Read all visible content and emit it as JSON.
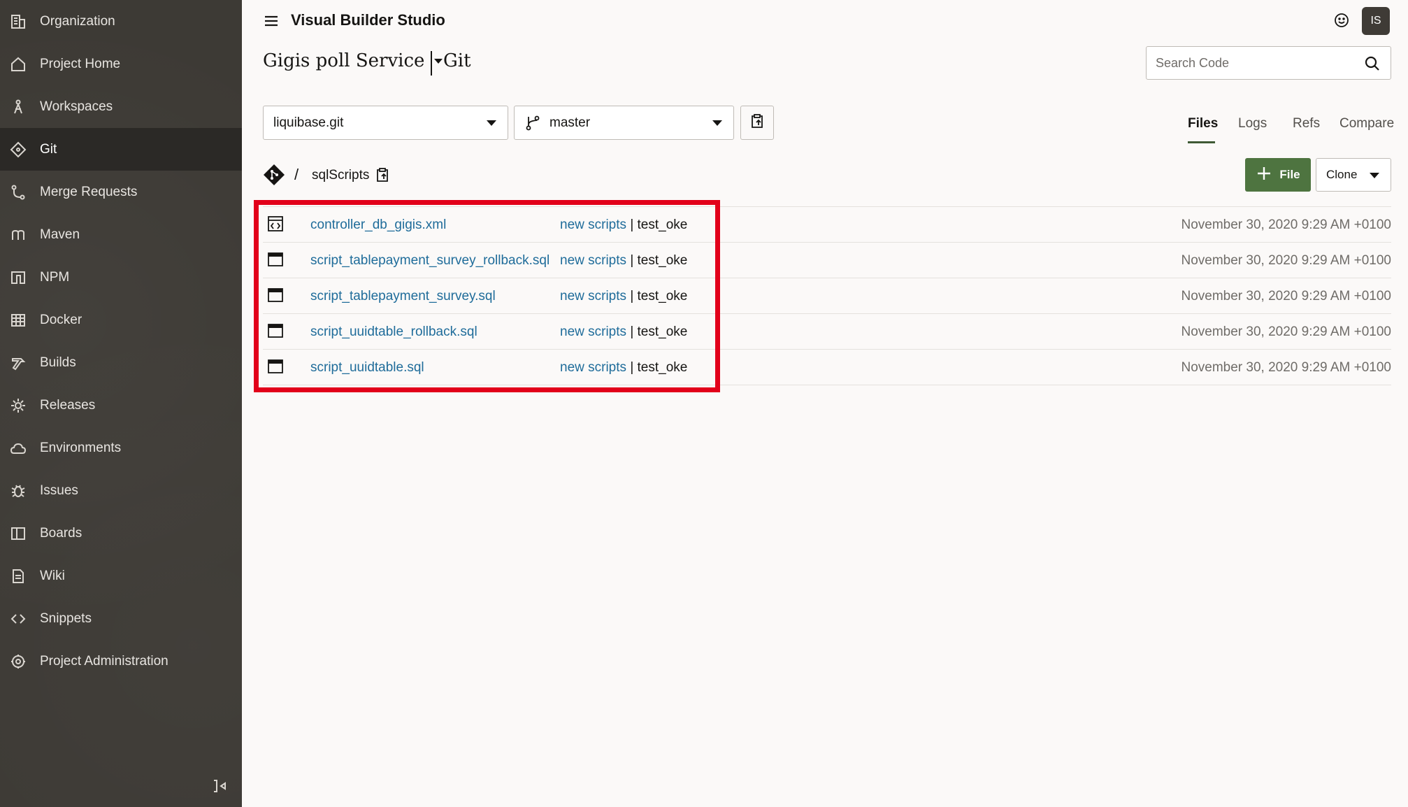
{
  "sidebar": {
    "items": [
      {
        "label": "Organization",
        "icon": "organization-icon"
      },
      {
        "label": "Project Home",
        "icon": "home-icon"
      },
      {
        "label": "Workspaces",
        "icon": "workspaces-icon"
      },
      {
        "label": "Git",
        "icon": "git-icon",
        "active": true
      },
      {
        "label": "Merge Requests",
        "icon": "merge-requests-icon"
      },
      {
        "label": "Maven",
        "icon": "maven-icon"
      },
      {
        "label": "NPM",
        "icon": "npm-icon"
      },
      {
        "label": "Docker",
        "icon": "docker-icon"
      },
      {
        "label": "Builds",
        "icon": "builds-icon"
      },
      {
        "label": "Releases",
        "icon": "releases-icon"
      },
      {
        "label": "Environments",
        "icon": "environments-icon"
      },
      {
        "label": "Issues",
        "icon": "issues-icon"
      },
      {
        "label": "Boards",
        "icon": "boards-icon"
      },
      {
        "label": "Wiki",
        "icon": "wiki-icon"
      },
      {
        "label": "Snippets",
        "icon": "snippets-icon"
      },
      {
        "label": "Project Administration",
        "icon": "settings-icon"
      }
    ]
  },
  "header": {
    "app_title": "Visual Builder Studio",
    "avatar_initials": "IS",
    "project_name": "Gigis poll Service",
    "section": "Git",
    "search_placeholder": "Search Code"
  },
  "repo": {
    "selected": "liquibase.git",
    "branch": "master"
  },
  "tabs": [
    {
      "label": "Files",
      "active": true
    },
    {
      "label": "Logs",
      "active": false
    },
    {
      "label": "Refs",
      "active": false
    },
    {
      "label": "Compare",
      "active": false
    }
  ],
  "breadcrumb": {
    "separator": "/",
    "directory": "sqlScripts"
  },
  "actions": {
    "add_file_label": "File",
    "clone_label": "Clone"
  },
  "files": [
    {
      "name": "controller_db_gigis.xml",
      "type": "xml",
      "commit_message": "new scripts",
      "commit_separator": "|",
      "author": "test_oke",
      "date": "November 30, 2020 9:29 AM +0100"
    },
    {
      "name": "script_tablepayment_survey_rollback.sql",
      "type": "file",
      "commit_message": "new scripts",
      "commit_separator": "|",
      "author": "test_oke",
      "date": "November 30, 2020 9:29 AM +0100"
    },
    {
      "name": "script_tablepayment_survey.sql",
      "type": "file",
      "commit_message": "new scripts",
      "commit_separator": "|",
      "author": "test_oke",
      "date": "November 30, 2020 9:29 AM +0100"
    },
    {
      "name": "script_uuidtable_rollback.sql",
      "type": "file",
      "commit_message": "new scripts",
      "commit_separator": "|",
      "author": "test_oke",
      "date": "November 30, 2020 9:29 AM +0100"
    },
    {
      "name": "script_uuidtable.sql",
      "type": "file",
      "commit_message": "new scripts",
      "commit_separator": "|",
      "author": "test_oke",
      "date": "November 30, 2020 9:29 AM +0100"
    }
  ],
  "colors": {
    "sidebar_bg": "#3d3a35",
    "link": "#1f6c9a",
    "primary_button": "#4e7440",
    "highlight_box": "#e2001a"
  }
}
